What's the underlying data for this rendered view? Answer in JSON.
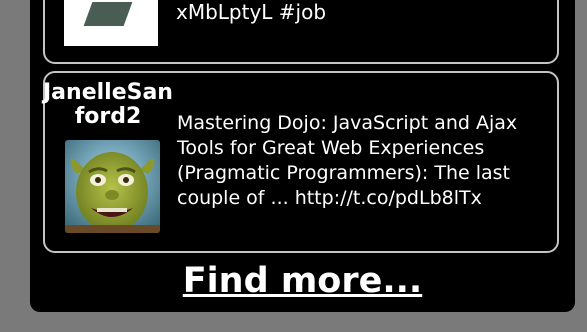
{
  "tweets": [
    {
      "text": "xMbLptyL #job"
    },
    {
      "username": "JanelleSanford2",
      "text": "Mastering Dojo: JavaScript and Ajax Tools for Great Web Experiences (Pragmatic Programmers): The last couple of ... http://t.co/pdLb8lTx",
      "avatar_icon": "shrek-avatar"
    }
  ],
  "footer": {
    "find_more_label": "Find more..."
  },
  "colors": {
    "background": "#7a7a7a",
    "panel": "#000000",
    "card_border": "#c4c4c4",
    "text": "#ffffff"
  }
}
